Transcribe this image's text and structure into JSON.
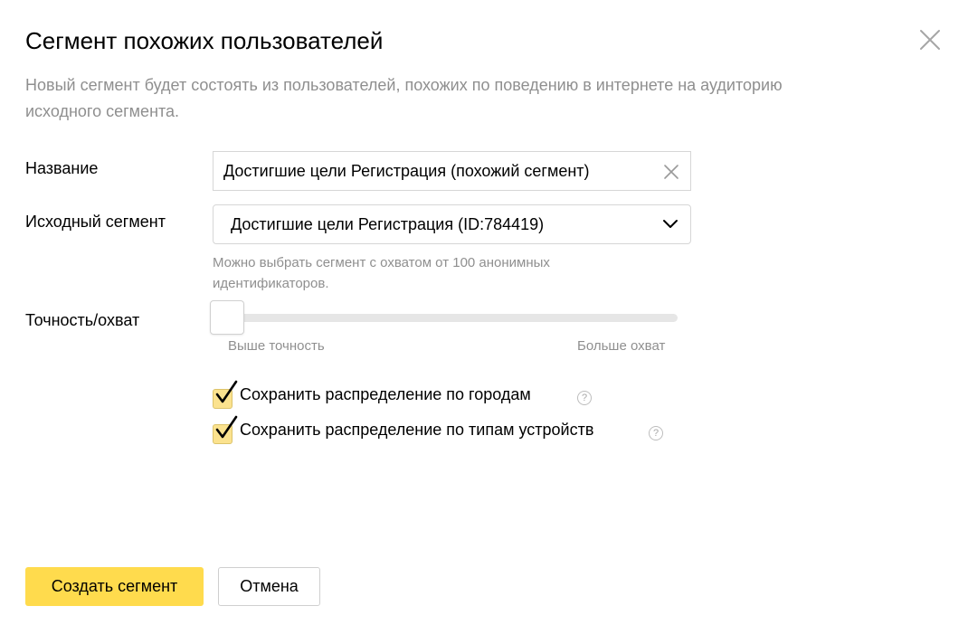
{
  "dialog": {
    "title": "Сегмент похожих пользователей",
    "description": "Новый сегмент будет состоять из пользователей, похожих по поведению в интернете на аудиторию исходного сегмента."
  },
  "name_field": {
    "label": "Название",
    "value": "Достигшие цели Регистрация (похожий сегмент)"
  },
  "source_segment": {
    "label": "Исходный сегмент",
    "selected": "Достигшие цели Регистрация (ID:784419)",
    "hint": "Можно выбрать сегмент с охватом от 100 анонимных идентификаторов."
  },
  "precision": {
    "label": "Точность/охват",
    "value": 0,
    "min_label": "Выше точность",
    "max_label": "Больше охват"
  },
  "options": [
    {
      "label": "Сохранить распределение по городам",
      "checked": true
    },
    {
      "label": "Сохранить распределение по типам устройств",
      "checked": true
    }
  ],
  "help_icon_text": "?",
  "buttons": {
    "create": "Создать сегмент",
    "cancel": "Отмена"
  },
  "colors": {
    "accent": "#ffdb4d",
    "checkbox_fill": "#fbe28e",
    "muted_text": "#8f8f8f"
  }
}
